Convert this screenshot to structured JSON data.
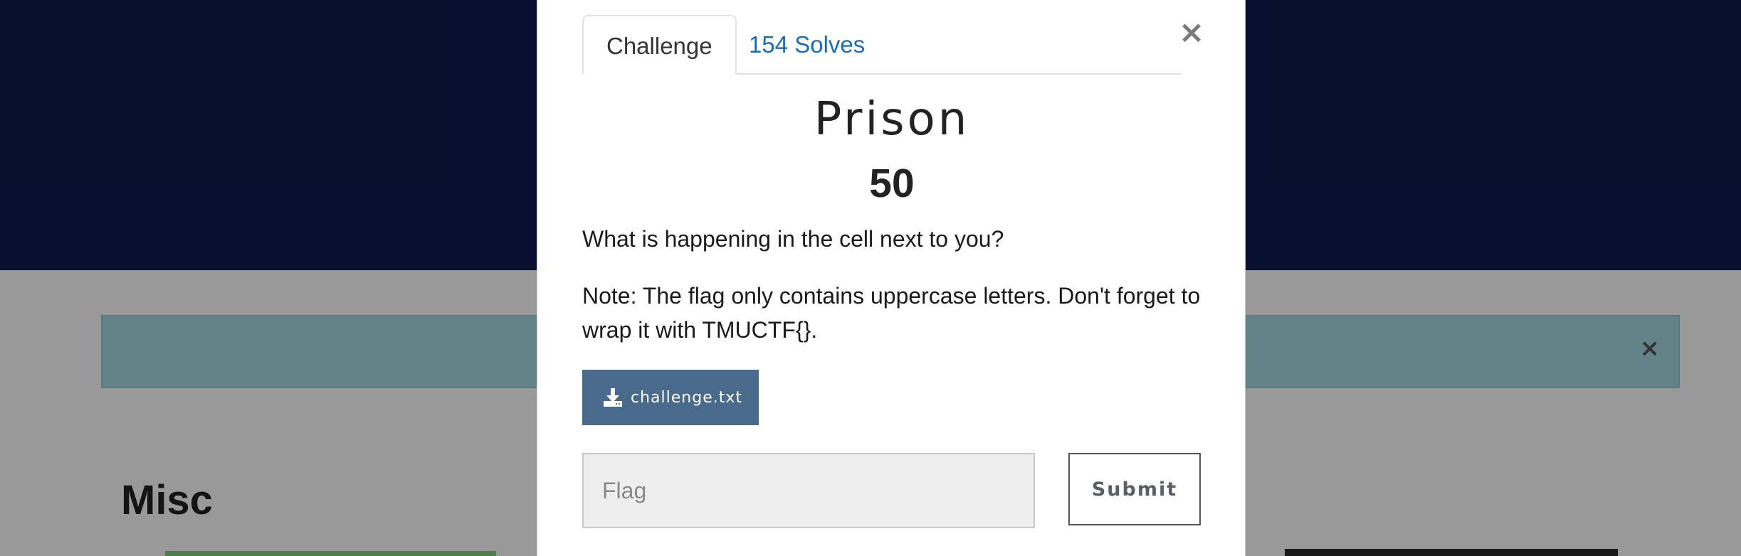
{
  "background": {
    "alert_close": "×",
    "section_title": "Misc"
  },
  "modal": {
    "close_label": "×",
    "tabs": [
      {
        "label": "Challenge"
      },
      {
        "label": "154 Solves"
      }
    ],
    "challenge": {
      "name": "Prison",
      "value": "50",
      "description": [
        "What is happening in the cell next to you?",
        "Note: The flag only contains uppercase letters. Don't forget to wrap it with TMUCTF{}."
      ],
      "file": {
        "name": "challenge.txt",
        "icon": "download-icon"
      }
    },
    "flag_input": {
      "placeholder": "Flag",
      "value": ""
    },
    "submit_label": "Submit"
  },
  "colors": {
    "header": "#0f1a4d",
    "alert": "#a7dae3",
    "download_button": "#4a6a8c",
    "link": "#1d6bb3"
  }
}
